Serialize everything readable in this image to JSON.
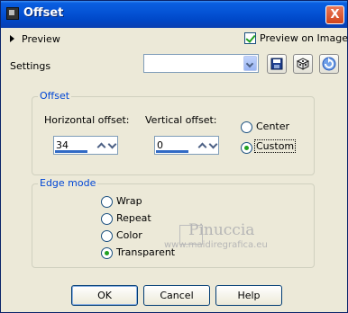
{
  "window": {
    "title": "Offset",
    "close": "X"
  },
  "preview": {
    "label": "Preview",
    "preview_on_image_label": "Preview on Image",
    "preview_on_image_checked": true
  },
  "settings": {
    "label": "Settings",
    "preset_value": ""
  },
  "offset_group": {
    "title": "Offset",
    "horizontal_label": "Horizontal offset:",
    "horizontal_value": "34",
    "vertical_label": "Vertical offset:",
    "vertical_value": "0",
    "center_label": "Center",
    "custom_label": "Custom",
    "selected": "Custom"
  },
  "edge_group": {
    "title": "Edge mode",
    "options": [
      "Wrap",
      "Repeat",
      "Color",
      "Transparent"
    ],
    "selected": "Transparent"
  },
  "watermark": {
    "name": "Pinuccia",
    "site": "www.maidiregrafica.eu"
  },
  "buttons": {
    "ok": "OK",
    "cancel": "Cancel",
    "help": "Help"
  },
  "icons": [
    "save-preset-icon",
    "randomize-dice-icon",
    "reset-icon",
    "close-icon"
  ],
  "colors": {
    "titlebar": "#0554d6",
    "dialog_bg": "#ece9d8",
    "group_title": "#0046d5",
    "check_green": "#21a121"
  }
}
